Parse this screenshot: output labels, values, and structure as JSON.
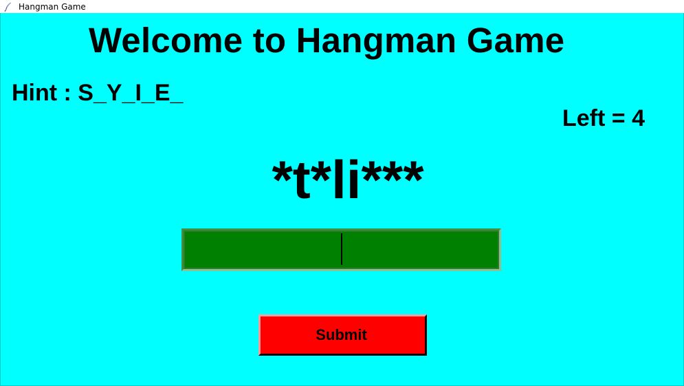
{
  "window": {
    "title": "Hangman Game",
    "icon": "feather-icon"
  },
  "game": {
    "heading": "Welcome to Hangman Game",
    "hint": "Hint : S_Y_I_E_",
    "left": "Left = 4",
    "masked_word": "*t*li***",
    "guess_input_value": "",
    "submit_label": "Submit"
  },
  "colors": {
    "background": "#00ffff",
    "entry": "#008000",
    "submit": "#ff0000"
  }
}
